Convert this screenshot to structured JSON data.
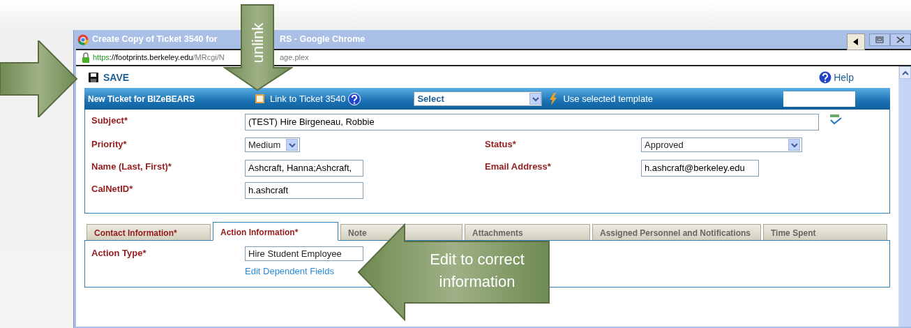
{
  "window": {
    "title_start": "Create Copy of Ticket 3540 for",
    "title_end": "RS - Google Chrome",
    "url": {
      "scheme": "https",
      "host": "://footprints.berkeley.edu",
      "path_start": "/MRcgi/N",
      "path_end": "age.plex"
    }
  },
  "toolbar": {
    "save": "SAVE",
    "help": "Help"
  },
  "header": {
    "title": "New Ticket for BIZeBEARS",
    "link_checkbox": {
      "label": "Link to Ticket 3540",
      "checked": false
    },
    "template_select": "Select",
    "template_action": "Use selected template"
  },
  "rows": [
    {
      "fields": [
        {
          "label": "Subject*",
          "kind": "text",
          "value": "(TEST) Hire Birgeneau, Robbie",
          "wide": true
        }
      ]
    },
    {
      "fields": [
        {
          "label": "Priority*",
          "kind": "select",
          "value": "Medium"
        },
        {
          "label": "Status*",
          "kind": "select",
          "value": "Approved"
        }
      ]
    },
    {
      "fields": [
        {
          "label": "Name (Last, First)*",
          "kind": "text",
          "value": "Ashcraft, Hanna;Ashcraft,"
        },
        {
          "label": "Email Address*",
          "kind": "text",
          "value": "h.ashcraft@berkeley.edu"
        }
      ]
    },
    {
      "fields": [
        {
          "label": "CalNetID*",
          "kind": "text",
          "value": "h.ashcraft"
        }
      ]
    }
  ],
  "tabs": [
    {
      "label": "Contact Information*",
      "selected": false,
      "required": true
    },
    {
      "label": "Action Information*",
      "selected": true,
      "required": true
    },
    {
      "label": "Note",
      "selected": false,
      "required": false
    },
    {
      "label": "Attachments",
      "selected": false,
      "required": false
    },
    {
      "label": "Assigned Personnel and Notifications",
      "selected": false,
      "required": false
    },
    {
      "label": "Time Spent",
      "selected": false,
      "required": false
    }
  ],
  "action_panel": {
    "label": "Action Type*",
    "value": "Hire Student Employee",
    "link": "Edit Dependent Fields"
  },
  "annotations": [
    {
      "kind": "arrow-right"
    },
    {
      "kind": "arrow-down",
      "text": "unlink"
    },
    {
      "kind": "arrow-left",
      "text": "Edit to correct information"
    }
  ]
}
